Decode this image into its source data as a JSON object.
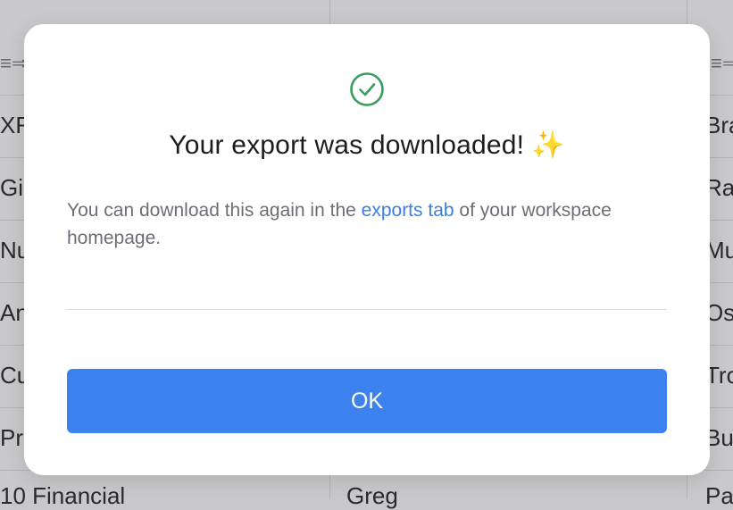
{
  "background": {
    "left_cells": [
      "XFa",
      "Gib",
      "Nu",
      "And",
      "Cu",
      "Pro",
      "10 Financial"
    ],
    "right_cells": [
      "Bra",
      "Ra",
      "Mu",
      "Os",
      "Tro",
      "Bu",
      "Pa"
    ],
    "middle_bottom": "Greg",
    "header_icon": "sort-icon"
  },
  "modal": {
    "icon": "check-circle-icon",
    "title": "Your export was downloaded!",
    "sparkle": "✨",
    "body_before": "You can download this again in the ",
    "body_link": "exports tab",
    "body_after": " of your workspace homepage.",
    "ok_label": "OK",
    "accent_color": "#3b82ee",
    "success_color": "#3b9b5b"
  }
}
